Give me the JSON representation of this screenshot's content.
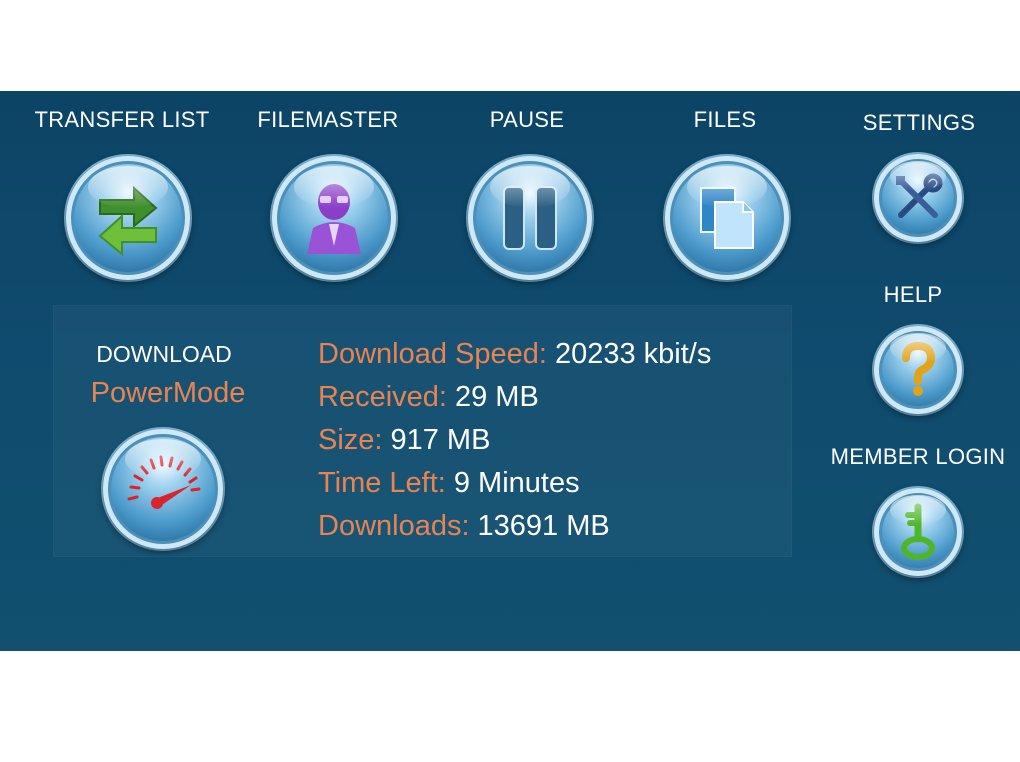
{
  "nav": {
    "transfer_list": "TRANSFER LIST",
    "filemaster": "FILEMASTER",
    "pause": "PAUSE",
    "files": "FILES",
    "settings": "SETTINGS",
    "help": "HELP",
    "member_login": "MEMBER LOGIN"
  },
  "download": {
    "title": "DOWNLOAD",
    "mode": "PowerMode"
  },
  "stats": {
    "speed_label": "Download Speed:",
    "speed_value": "20233 kbit/s",
    "received_label": "Received:",
    "received_value": "29 MB",
    "size_label": "Size:",
    "size_value": "917 MB",
    "time_left_label": "Time Left:",
    "time_left_value": "9 Minutes",
    "downloads_label": "Downloads:",
    "downloads_value": "13691 MB"
  },
  "icons": {
    "transfer_list": "transfer-arrows-icon",
    "filemaster": "filemaster-agent-icon",
    "pause": "pause-icon",
    "files": "files-icon",
    "settings": "tools-icon",
    "help": "question-mark-icon",
    "member_login": "key-icon",
    "powermode": "speedometer-icon"
  },
  "colors": {
    "panel_background": "#0f4a6c",
    "label_accent": "#e78451",
    "value_text": "#ffffff"
  }
}
